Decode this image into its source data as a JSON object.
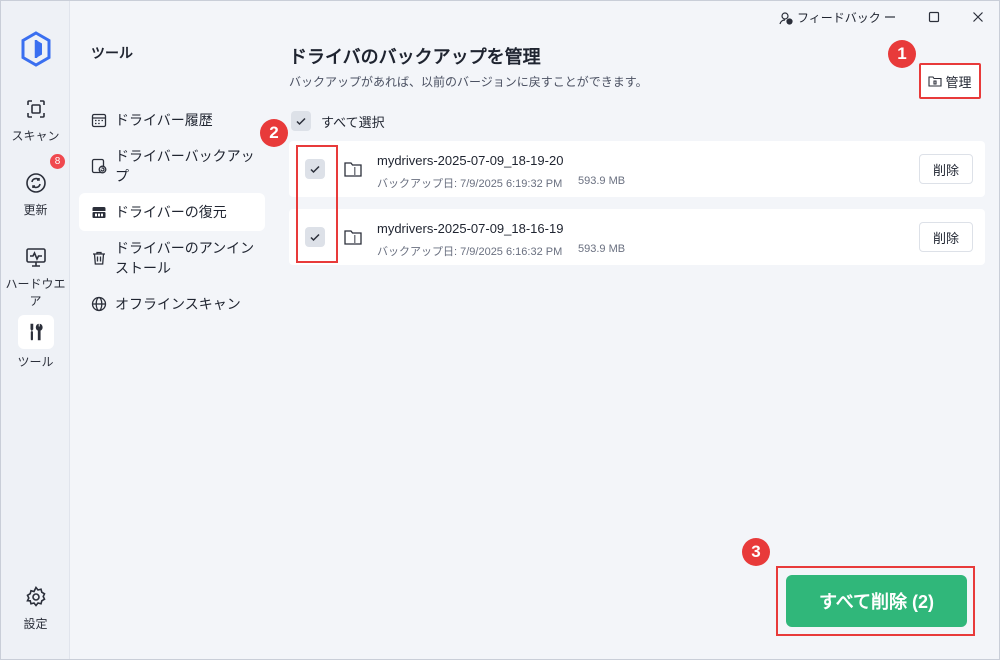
{
  "rail": {
    "items": [
      {
        "label": "スキャン",
        "icon": "scan-icon"
      },
      {
        "label": "更新",
        "icon": "update-icon",
        "badge": "8"
      },
      {
        "label": "ハードウエア",
        "icon": "hardware-icon"
      },
      {
        "label": "ツール",
        "icon": "tools-icon"
      },
      {
        "label": "設定",
        "icon": "settings-icon"
      }
    ]
  },
  "subnav": {
    "title": "ツール",
    "items": [
      {
        "label": "ドライバー履歴",
        "icon": "calendar-icon"
      },
      {
        "label": "ドライバーバックアップ",
        "icon": "backup-icon"
      },
      {
        "label": "ドライバーの復元",
        "icon": "restore-icon"
      },
      {
        "label": "ドライバーのアンインストール",
        "icon": "trash-icon"
      },
      {
        "label": "オフラインスキャン",
        "icon": "globe-icon"
      }
    ]
  },
  "titlebar": {
    "feedback": "フィードバック"
  },
  "main": {
    "title": "ドライバのバックアップを管理",
    "subtitle": "バックアップがあれば、以前のバージョンに戻すことができます。",
    "manage_label": "管理",
    "select_all": "すべて選択",
    "backups": [
      {
        "name": "mydrivers-2025-07-09_18-19-20",
        "date": "バックアップ日: 7/9/2025 6:19:32 PM",
        "size": "593.9 MB",
        "delete": "削除",
        "checked": true
      },
      {
        "name": "mydrivers-2025-07-09_18-16-19",
        "date": "バックアップ日: 7/9/2025 6:16:32 PM",
        "size": "593.9 MB",
        "delete": "削除",
        "checked": true
      }
    ],
    "delete_all": "すべて削除 (2)"
  },
  "callouts": [
    "1",
    "2",
    "3"
  ],
  "colors": {
    "accent_green": "#30b77a",
    "highlight_red": "#e83a3a",
    "badge_red": "#f0494f",
    "logo_blue": "#3a6ff0"
  }
}
